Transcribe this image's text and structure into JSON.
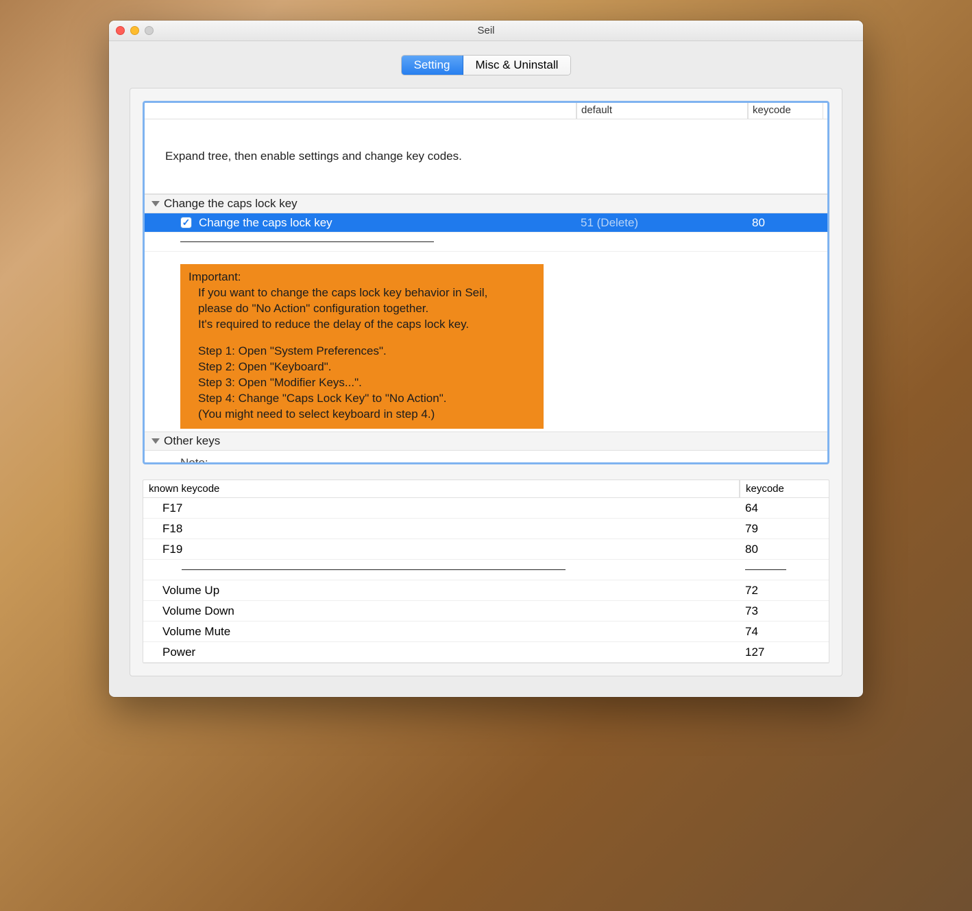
{
  "window": {
    "title": "Seil"
  },
  "tabs": {
    "setting": "Setting",
    "misc": "Misc & Uninstall"
  },
  "tree": {
    "headers": {
      "default": "default",
      "keycode": "keycode"
    },
    "intro": "Expand tree, then enable settings and change key codes.",
    "groups": {
      "capslock": {
        "label": "Change the caps lock key",
        "item": {
          "label": "Change the caps lock key",
          "default": "51 (Delete)",
          "keycode": "80",
          "checked": true
        },
        "note": {
          "title": "Important:",
          "lines": [
            "If you want to change the caps lock key behavior in Seil,",
            "please do \"No Action\" configuration together.",
            "It's required to reduce the delay of the caps lock key."
          ],
          "steps": [
            "Step 1: Open \"System Preferences\".",
            "Step 2: Open \"Keyboard\".",
            "Step 3: Open \"Modifier Keys...\".",
            "Step 4: Change \"Caps Lock Key\" to \"No Action\"."
          ],
          "footnote": "(You might need to select keyboard in step 4.)"
        }
      },
      "other": {
        "label": "Other keys",
        "trailing": "Note:"
      }
    }
  },
  "keycode_table": {
    "headers": {
      "name": "known keycode",
      "code": "keycode"
    },
    "rows": [
      {
        "name": "F17",
        "code": "64"
      },
      {
        "name": "F18",
        "code": "79"
      },
      {
        "name": "F19",
        "code": "80"
      },
      {
        "sep": true
      },
      {
        "name": "Volume Up",
        "code": "72"
      },
      {
        "name": "Volume Down",
        "code": "73"
      },
      {
        "name": "Volume Mute",
        "code": "74"
      },
      {
        "name": "Power",
        "code": "127"
      }
    ]
  }
}
